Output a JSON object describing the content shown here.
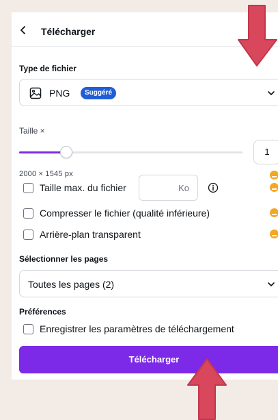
{
  "header": {
    "title": "Télécharger",
    "back_icon": "chevron-left-icon"
  },
  "file_type": {
    "label": "Type de fichier",
    "value": "PNG",
    "badge": "Suggéré",
    "icon": "image-icon",
    "badge_color": "#1f5ed6"
  },
  "size": {
    "label": "Taille ×",
    "value": "1",
    "slider_fraction": 0.21,
    "dimensions": "2000 × 1545 px"
  },
  "options": {
    "max_size": {
      "label": "Taille max. du fichier",
      "unit": "Ko",
      "checked": false
    },
    "compress": {
      "label": "Compresser le fichier (qualité inférieure)",
      "checked": false
    },
    "transparent": {
      "label": "Arrière-plan transparent",
      "checked": false
    }
  },
  "pages": {
    "label": "Sélectionner les pages",
    "value": "Toutes les pages (2)"
  },
  "preferences": {
    "label": "Préférences",
    "save_settings": "Enregistrer les paramètres de téléchargement",
    "checked": false
  },
  "download_button": "Télécharger",
  "colors": {
    "accent": "#7d2ae8",
    "premium": "#f5a623",
    "annotation_arrow": "#d9475c",
    "background": "#f3ebe6"
  }
}
